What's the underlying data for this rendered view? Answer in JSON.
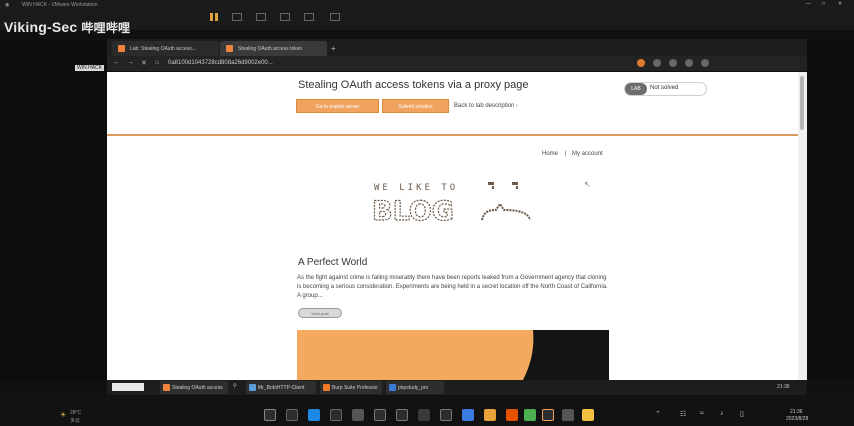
{
  "vm": {
    "window_title": "WIN HACK - VMware Workstation",
    "watermark": "Viking-Sec",
    "watermark_cjk": "哔哩哔哩",
    "library_item": "WIN HACK"
  },
  "browser": {
    "tabs": [
      {
        "label": "Lab: Stealing OAuth access..."
      },
      {
        "label": "Stealing OAuth access token"
      }
    ],
    "url": "0a8100d1043728cd808a26d9002e00..."
  },
  "lab": {
    "title": "Stealing OAuth access tokens via a proxy page",
    "btn_exploit": "Go to exploit server",
    "btn_submit": "Submit solution",
    "back_link": "Back to lab description",
    "status_badge": "LAB",
    "status_text": "Not solved"
  },
  "blog": {
    "nav_home": "Home",
    "nav_sep": "|",
    "nav_account": "My account",
    "logo_top": "WE LIKE TO",
    "logo_main": "BLOG",
    "post_title": "A Perfect World",
    "post_excerpt": "As the fight against crime is failing miserably there have been reports leaked from a Government agency that cloning is becoming a serious consideration. Experiments are being held in a secret location off the North Coast of California. A group...",
    "view_post": "View post"
  },
  "guest_taskbar": {
    "items": [
      {
        "label": "Stealing OAuth access",
        "color": "#f0843c"
      },
      {
        "label": "Mr_Bob\\HTTP-Client",
        "color": "#5a9bd5"
      },
      {
        "label": "Burp Suite Professio",
        "color": "#f07a2a"
      },
      {
        "label": "phpstudy_pro",
        "color": "#3a7bd5"
      }
    ],
    "clock": "21:36"
  },
  "host": {
    "weather_temp": "28°C",
    "weather_desc": "多云",
    "clock_time": "21:36",
    "clock_date": "2023/8/28"
  },
  "colors": {
    "accent_orange": "#f0a35e",
    "rule": "#d89b5d"
  }
}
